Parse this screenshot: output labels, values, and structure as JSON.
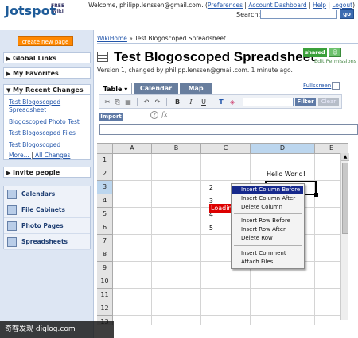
{
  "header": {
    "logo_text": "Jotspot",
    "logo_badge_line1": "FREE",
    "logo_badge_line2": "Wiki",
    "welcome_prefix": "Welcome, philipp.lenssen@gmail.com. (",
    "welcome_links": [
      "Preferences",
      "Account Dashboard",
      "Help",
      "Logout"
    ],
    "welcome_separator": " | ",
    "welcome_suffix": ")",
    "search_label": "Search:",
    "search_value": "",
    "go_label": "go"
  },
  "sidebar": {
    "create_label": "create new page",
    "sections": [
      {
        "label": "Global Links"
      },
      {
        "label": "My Favorites"
      },
      {
        "label": "My Recent Changes"
      }
    ],
    "recent_links": [
      "Test Blogoscoped",
      "Spreadsheet",
      "Blogoscoped Photo Test",
      "Test Blogoscoped Files",
      "Test Blogoscoped"
    ],
    "more_label": "More...",
    "more_sep": " | ",
    "all_changes_label": "All Changes",
    "invite_label": "Invite people",
    "tools": [
      {
        "label": "Calendars",
        "icon": "calendar-icon"
      },
      {
        "label": "File Cabinets",
        "icon": "file-cabinet-icon"
      },
      {
        "label": "Photo Pages",
        "icon": "photo-icon"
      },
      {
        "label": "Spreadsheets",
        "icon": "spreadsheet-icon"
      }
    ]
  },
  "main": {
    "breadcrumb_home": "WikiHome",
    "breadcrumb_sep": " » ",
    "breadcrumb_current": "Test Blogoscoped Spreadsheet",
    "title": "Test Blogoscoped Spreadsheet",
    "version": "Version 1, changed by philipp.lenssen@gmail.com. 1 minute ago.",
    "shared_label": "shared",
    "permissions_label": "Edit Permissions",
    "tabs": [
      {
        "label": "Table ▾"
      },
      {
        "label": "Calendar"
      },
      {
        "label": "Map"
      }
    ],
    "fullscreen_label": "Fullscreen"
  },
  "toolbar": {
    "buttons": [
      "✂",
      "⎘",
      "▤",
      "↶",
      "↷",
      "B",
      "I",
      "U",
      "T",
      "◈"
    ],
    "filter_label": "Filter",
    "clear_label": "Clear",
    "filter_value": "",
    "import_label": "Import",
    "help_label": "?",
    "fx_label": "fx",
    "formula_value": ""
  },
  "sheet": {
    "columns": [
      "A",
      "B",
      "C",
      "D",
      "E"
    ],
    "rows": [
      "1",
      "2",
      "3",
      "4",
      "5",
      "6",
      "7",
      "8",
      "9",
      "10",
      "11",
      "12",
      "13"
    ],
    "selected_column": "D",
    "selected_row": "3",
    "cells": {
      "D2": "Hello World!",
      "B3": "2",
      "B4": "3",
      "C4_label": "Loading",
      "B5": "4",
      "B6": "5"
    }
  },
  "context_menu": {
    "items_group1": [
      "Insert Column Before",
      "Insert Column After",
      "Delete Column"
    ],
    "items_group2": [
      "Insert Row Before",
      "Insert Row After",
      "Delete Row"
    ],
    "items_group3": [
      "Insert Comment",
      "Attach Files"
    ],
    "highlighted": "Insert Column Before"
  },
  "watermark": "奇客发现 diglog.com"
}
